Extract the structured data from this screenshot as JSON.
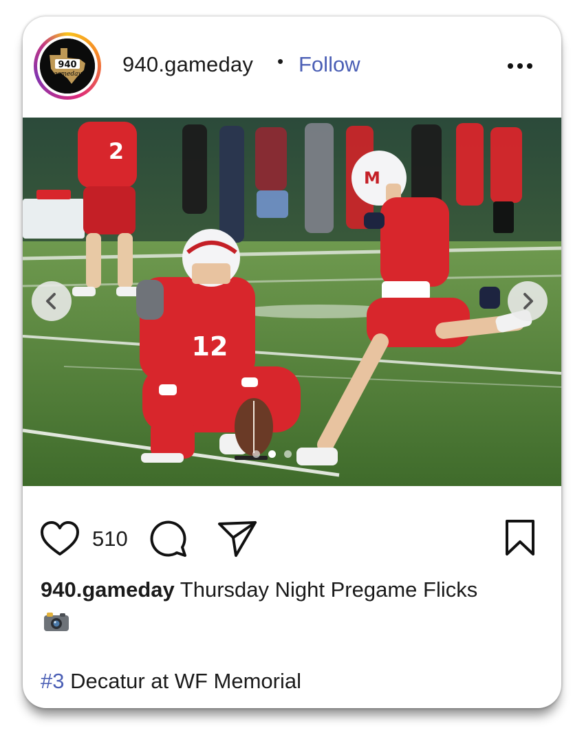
{
  "post": {
    "username": "940.gameday",
    "separator": "•",
    "follow_label": "Follow",
    "avatar_logo_text": "940 gameday",
    "carousel": {
      "slide_count": 3,
      "active_index": 1
    },
    "likes": "510",
    "caption_user": "940.gameday",
    "caption_text": " Thursday Night Pregame Flicks",
    "caption_emoji": "camera-emoji",
    "hashtag": "#3",
    "hashtag_rest": " Decatur at WF Memorial",
    "jersey_numbers": [
      "2",
      "12"
    ],
    "icons": {
      "more": "more-horizontal-icon",
      "prev": "chevron-left-icon",
      "next": "chevron-right-icon",
      "like": "heart-icon",
      "comment": "comment-icon",
      "share": "send-icon",
      "save": "bookmark-icon"
    },
    "colors": {
      "accent": "#4b5fb5",
      "text": "#1a1a1a",
      "jersey_red": "#d8262c"
    }
  }
}
